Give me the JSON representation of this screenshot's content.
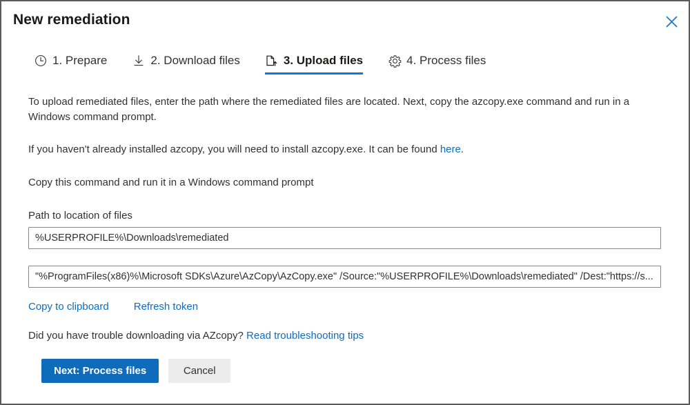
{
  "window": {
    "title": "New remediation",
    "close_label": "Close",
    "close_icon": "close-icon",
    "accent_color": "#0f6cbd",
    "tab_underline_color": "#0f7ad6",
    "border_color": "#5a5a5a"
  },
  "tabs": [
    {
      "label": "1. Prepare",
      "icon": "clock-icon",
      "active": false
    },
    {
      "label": "2. Download files",
      "icon": "download-arrow-icon",
      "active": false
    },
    {
      "label": "3. Upload files",
      "icon": "file-upload-icon",
      "active": true
    },
    {
      "label": "4. Process files",
      "icon": "gear-icon",
      "active": false
    }
  ],
  "main": {
    "intro_paragraph": "To upload remediated files, enter the path where the remediated files are located. Next, copy the azcopy.exe command and run in a Windows command prompt.",
    "install_text_before": "If you haven't already installed azcopy, you will need to install azcopy.exe. It can be found ",
    "install_link_text": "here",
    "install_text_after": ".",
    "copy_instruction": "Copy this command and run it in a Windows command prompt",
    "path_label": "Path to location of files",
    "path_value": "%USERPROFILE%\\Downloads\\remediated",
    "path_placeholder": "Path to location of files",
    "command_value": "\"%ProgramFiles(x86)%\\Microsoft SDKs\\Azure\\AzCopy\\AzCopy.exe\" /Source:\"%USERPROFILE%\\Downloads\\remediated\" /Dest:\"https://s...",
    "command_placeholder": "AzCopy command",
    "copy_to_clipboard_label": "Copy to clipboard",
    "refresh_token_label": "Refresh token",
    "trouble_text": "Did you have trouble downloading via AZcopy? ",
    "trouble_link_text": "Read troubleshooting tips"
  },
  "footer": {
    "next_label": "Next: Process files",
    "cancel_label": "Cancel"
  }
}
